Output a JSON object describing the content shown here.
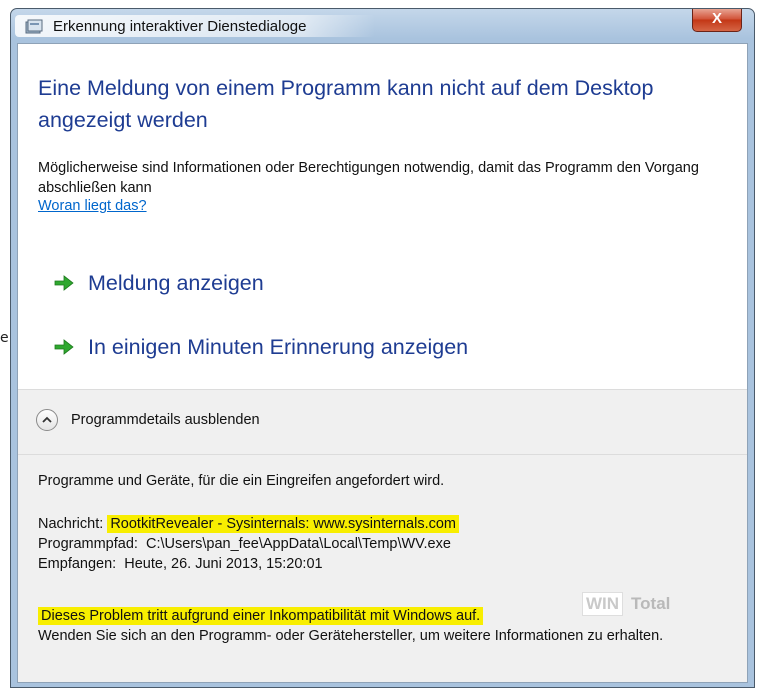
{
  "stray_char": "e",
  "window": {
    "title": "Erkennung interaktiver Dienstedialoge",
    "close_label": "X"
  },
  "main": {
    "heading": "Eine Meldung von einem Programm kann nicht auf dem Desktop angezeigt werden",
    "description": "Möglicherweise sind Informationen oder Berechtigungen notwendig, damit das Programm den Vorgang abschließen kann",
    "help_link": "Woran liegt das?",
    "commands": [
      {
        "label": "Meldung anzeigen",
        "icon": "green-arrow-icon"
      },
      {
        "label": "In einigen Minuten Erinnerung anzeigen",
        "icon": "green-arrow-icon"
      }
    ]
  },
  "details": {
    "toggle_label": "Programmdetails ausblenden",
    "intro": "Programme und Geräte, für die ein Eingreifen angefordert wird.",
    "message_label": "Nachricht:",
    "message_value": "RootkitRevealer - Sysinternals: www.sysinternals.com",
    "path_label": "Programmpfad:",
    "path_value": "C:\\Users\\pan_fee\\AppData\\Local\\Temp\\WV.exe",
    "received_label": "Empfangen:",
    "received_value": "Heute, 26. Juni 2013, 15:20:01",
    "problem_text": "Dieses Problem tritt aufgrund einer Inkompatibilität mit Windows auf.",
    "advice_text": "Wenden Sie sich an den Programm- oder Gerätehersteller, um weitere Informationen zu erhalten."
  },
  "watermark": {
    "box": "WIN",
    "text": "Total"
  },
  "colors": {
    "heading_blue": "#1e3c92",
    "link_blue": "#0066cc",
    "highlight_yellow": "#f8ee00",
    "arrow_green": "#2fa82f",
    "close_red": "#c33716"
  }
}
